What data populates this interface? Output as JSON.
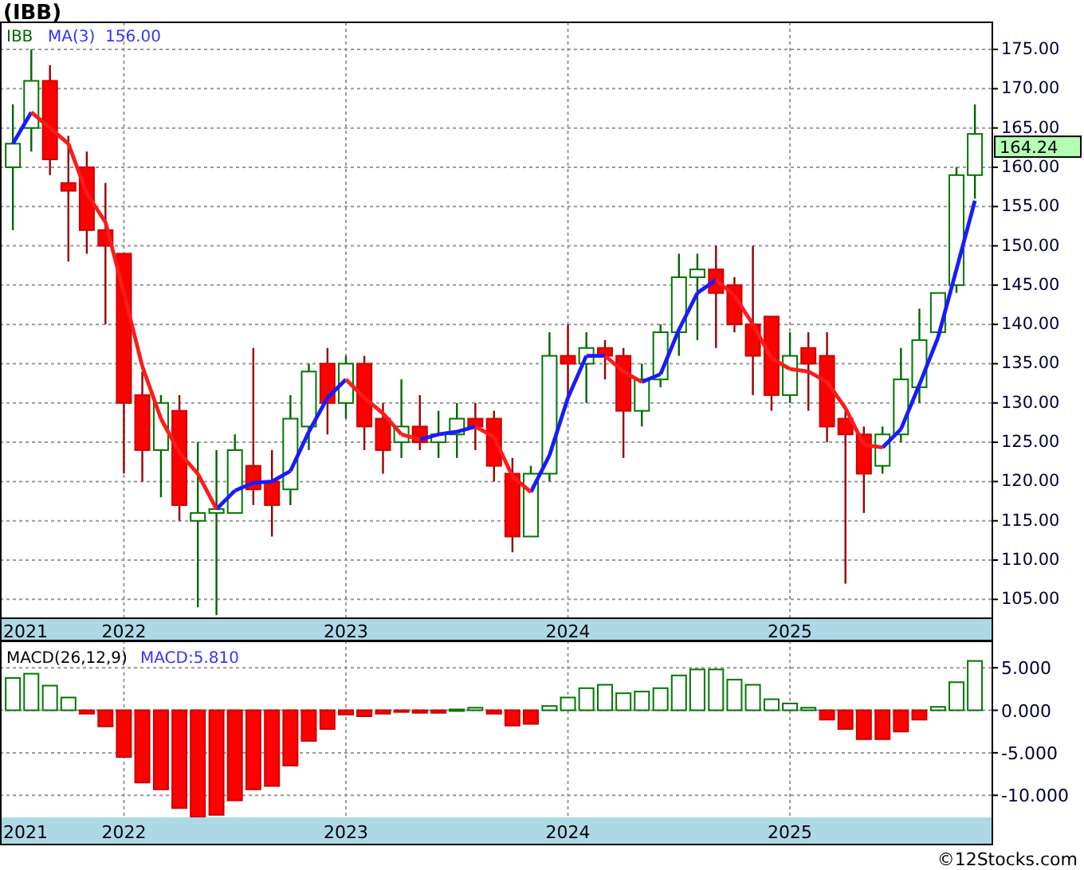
{
  "title": "(IBB)",
  "price_panel": {
    "legend": {
      "symbol": "IBB",
      "ma_label": "MA(3)",
      "ma_value": "156.00"
    },
    "last_price": "164.24",
    "edge_label": "2021",
    "chart_data": {
      "type": "candlestick",
      "xlim": [
        2021.442,
        2025.908
      ],
      "ylim": [
        102.6,
        178.45
      ],
      "x": [
        2021.5,
        2021.583,
        2021.667,
        2021.75,
        2021.833,
        2021.917,
        2022,
        2022.083,
        2022.167,
        2022.25,
        2022.333,
        2022.417,
        2022.5,
        2022.583,
        2022.667,
        2022.75,
        2022.833,
        2022.917,
        2023,
        2023.083,
        2023.167,
        2023.25,
        2023.333,
        2023.417,
        2023.5,
        2023.583,
        2023.667,
        2023.75,
        2023.833,
        2023.917,
        2024,
        2024.083,
        2024.167,
        2024.25,
        2024.333,
        2024.417,
        2024.5,
        2024.583,
        2024.667,
        2024.75,
        2024.833,
        2024.917,
        2025,
        2025.083,
        2025.167,
        2025.25,
        2025.333,
        2025.417,
        2025.5,
        2025.583,
        2025.667,
        2025.75,
        2025.833
      ],
      "ohlc": [
        [
          160,
          168,
          152,
          163
        ],
        [
          165,
          175,
          162,
          171
        ],
        [
          171,
          173,
          159,
          161
        ],
        [
          158,
          164,
          148,
          157
        ],
        [
          160,
          162,
          149,
          152
        ],
        [
          152,
          158,
          140,
          150
        ],
        [
          149,
          149,
          121,
          130
        ],
        [
          131,
          134,
          120,
          124
        ],
        [
          124,
          131,
          118,
          130
        ],
        [
          129,
          131,
          115,
          117
        ],
        [
          115,
          125,
          104,
          116
        ],
        [
          116,
          124,
          103,
          116.5
        ],
        [
          116,
          126,
          116,
          124
        ],
        [
          122,
          137,
          117,
          119
        ],
        [
          120,
          124,
          113,
          117
        ],
        [
          119,
          131,
          117,
          128
        ],
        [
          127,
          135,
          124,
          134
        ],
        [
          135,
          137,
          126,
          130
        ],
        [
          130,
          136,
          128,
          135
        ],
        [
          135,
          136,
          124,
          127
        ],
        [
          128,
          130,
          121,
          124
        ],
        [
          125,
          133,
          123,
          127
        ],
        [
          127,
          131,
          124,
          125
        ],
        [
          125,
          129,
          123,
          126
        ],
        [
          126,
          130,
          123,
          128
        ],
        [
          128,
          130,
          124,
          127
        ],
        [
          128,
          129,
          120,
          122
        ],
        [
          121,
          123,
          111,
          113
        ],
        [
          113,
          122,
          113,
          121
        ],
        [
          121,
          139,
          120,
          136
        ],
        [
          136,
          140,
          131,
          135
        ],
        [
          135,
          139,
          130,
          137
        ],
        [
          137,
          138,
          133,
          136
        ],
        [
          136,
          137,
          123,
          129
        ],
        [
          129,
          135,
          127,
          133
        ],
        [
          133,
          140,
          132,
          139
        ],
        [
          139,
          149,
          136,
          146
        ],
        [
          146,
          149,
          138,
          147
        ],
        [
          147,
          150,
          137,
          144
        ],
        [
          145,
          146,
          139,
          140
        ],
        [
          140,
          150,
          131,
          136
        ],
        [
          141,
          141,
          129,
          131
        ],
        [
          131,
          139,
          130,
          136
        ],
        [
          137,
          139,
          129,
          135
        ],
        [
          136,
          139,
          125,
          127
        ],
        [
          128,
          129,
          107,
          126
        ],
        [
          126,
          127,
          116,
          121
        ],
        [
          122,
          127,
          121,
          126
        ],
        [
          126,
          137,
          125,
          133
        ],
        [
          132,
          142,
          130,
          138
        ],
        [
          139,
          144,
          139,
          144
        ],
        [
          145,
          160,
          144,
          159
        ],
        [
          159,
          168,
          156,
          164.24
        ]
      ],
      "yticks": [
        {
          "value": 105,
          "label": "105.00"
        },
        {
          "value": 110,
          "label": "110.00"
        },
        {
          "value": 115,
          "label": "115.00"
        },
        {
          "value": 120,
          "label": "120.00"
        },
        {
          "value": 125,
          "label": "125.00"
        },
        {
          "value": 130,
          "label": "130.00"
        },
        {
          "value": 135,
          "label": "135.00"
        },
        {
          "value": 140,
          "label": "140.00"
        },
        {
          "value": 145,
          "label": "145.00"
        },
        {
          "value": 150,
          "label": "150.00"
        },
        {
          "value": 155,
          "label": "155.00"
        },
        {
          "value": 160,
          "label": "160.00"
        },
        {
          "value": 165,
          "label": "165.00"
        },
        {
          "value": 170,
          "label": "170.00"
        },
        {
          "value": 175,
          "label": "175.00"
        }
      ],
      "xticks": [
        2022,
        2023,
        2024,
        2025
      ]
    }
  },
  "macd_panel": {
    "value_label": "MACD:5.810",
    "edge_label": "2021",
    "chart_data": {
      "type": "bar",
      "title": "MACD(26,12,9)",
      "xlim": [
        2021.442,
        2025.908
      ],
      "ylim": [
        -12.6,
        8.2
      ],
      "x": [
        2021.5,
        2021.583,
        2021.667,
        2021.75,
        2021.833,
        2021.917,
        2022,
        2022.083,
        2022.167,
        2022.25,
        2022.333,
        2022.417,
        2022.5,
        2022.583,
        2022.667,
        2022.75,
        2022.833,
        2022.917,
        2023,
        2023.083,
        2023.167,
        2023.25,
        2023.333,
        2023.417,
        2023.5,
        2023.583,
        2023.667,
        2023.75,
        2023.833,
        2023.917,
        2024,
        2024.083,
        2024.167,
        2024.25,
        2024.333,
        2024.417,
        2024.5,
        2024.583,
        2024.667,
        2024.75,
        2024.833,
        2024.917,
        2025,
        2025.083,
        2025.167,
        2025.25,
        2025.333,
        2025.417,
        2025.5,
        2025.583,
        2025.667,
        2025.75,
        2025.833
      ],
      "values": [
        3.8,
        4.3,
        2.9,
        1.5,
        -0.4,
        -1.9,
        -5.5,
        -8.5,
        -9.3,
        -11.5,
        -12.5,
        -12.3,
        -10.6,
        -9.3,
        -8.9,
        -6.5,
        -3.6,
        -2.2,
        -0.5,
        -0.7,
        -0.4,
        -0.2,
        -0.3,
        -0.3,
        0.1,
        0.3,
        -0.4,
        -1.8,
        -1.6,
        0.5,
        1.5,
        2.6,
        3.0,
        2.0,
        2.2,
        2.6,
        4.1,
        4.8,
        4.8,
        3.6,
        3.0,
        1.3,
        0.8,
        0.3,
        -1.1,
        -2.2,
        -3.4,
        -3.4,
        -2.5,
        -1.1,
        0.4,
        3.3,
        5.8
      ],
      "yticks": [
        {
          "value": 5,
          "label": "5.000"
        },
        {
          "value": 0,
          "label": "0.000"
        },
        {
          "value": -5,
          "label": "-5.000"
        },
        {
          "value": -10,
          "label": "-10.000"
        }
      ],
      "xticks": [
        2022,
        2023,
        2024,
        2025
      ]
    }
  },
  "credit": "©12Stocks.com"
}
